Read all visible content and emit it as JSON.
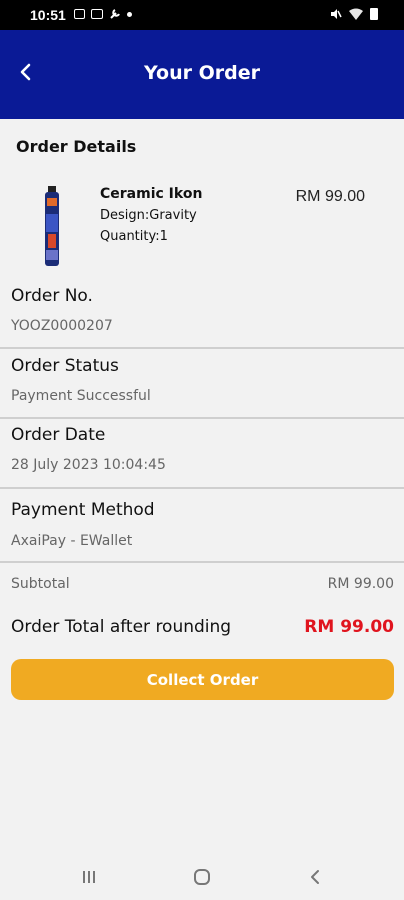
{
  "status_bar": {
    "time": "10:51"
  },
  "app_bar": {
    "title": "Your Order"
  },
  "order_details": {
    "title": "Order Details",
    "item": {
      "name": "Ceramic Ikon",
      "design": "Design:Gravity",
      "quantity": "Quantity:1",
      "price": "RM 99.00"
    }
  },
  "fields": {
    "order_no": {
      "label": "Order No.",
      "value": "YOOZ0000207"
    },
    "order_status": {
      "label": "Order Status",
      "value": "Payment Successful"
    },
    "order_date": {
      "label": "Order Date",
      "value": "28 July 2023 10:04:45"
    },
    "payment_method": {
      "label": "Payment Method",
      "value": "AxaiPay - EWallet"
    }
  },
  "summary": {
    "subtotal_label": "Subtotal",
    "subtotal_value": "RM 99.00",
    "total_label": "Order Total after rounding",
    "total_value": "RM 99.00"
  },
  "actions": {
    "collect_label": "Collect Order"
  },
  "colors": {
    "app_bar": "#0a1a96",
    "accent_button": "#f0aa22",
    "total_red": "#e0141e"
  }
}
